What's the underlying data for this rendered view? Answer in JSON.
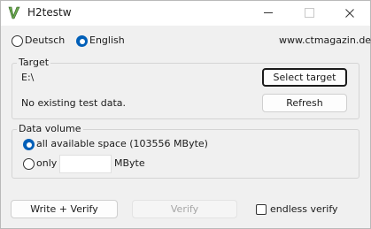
{
  "window": {
    "title": "H2testw"
  },
  "language": {
    "options": [
      "Deutsch",
      "English"
    ],
    "selected": "English"
  },
  "website": "www.ctmagazin.de",
  "target": {
    "group_label": "Target",
    "path": "E:\\",
    "status": "No existing test data.",
    "select_button": "Select target",
    "refresh_button": "Refresh"
  },
  "data_volume": {
    "group_label": "Data volume",
    "all_space_label": "all available space (103556 MByte)",
    "only_label": "only",
    "only_value": "",
    "unit_label": "MByte",
    "selected": "all"
  },
  "actions": {
    "write_verify": "Write + Verify",
    "verify": "Verify",
    "endless_verify": "endless verify"
  },
  "colors": {
    "accent": "#005fb8",
    "window_bg": "#f0f0f0"
  }
}
